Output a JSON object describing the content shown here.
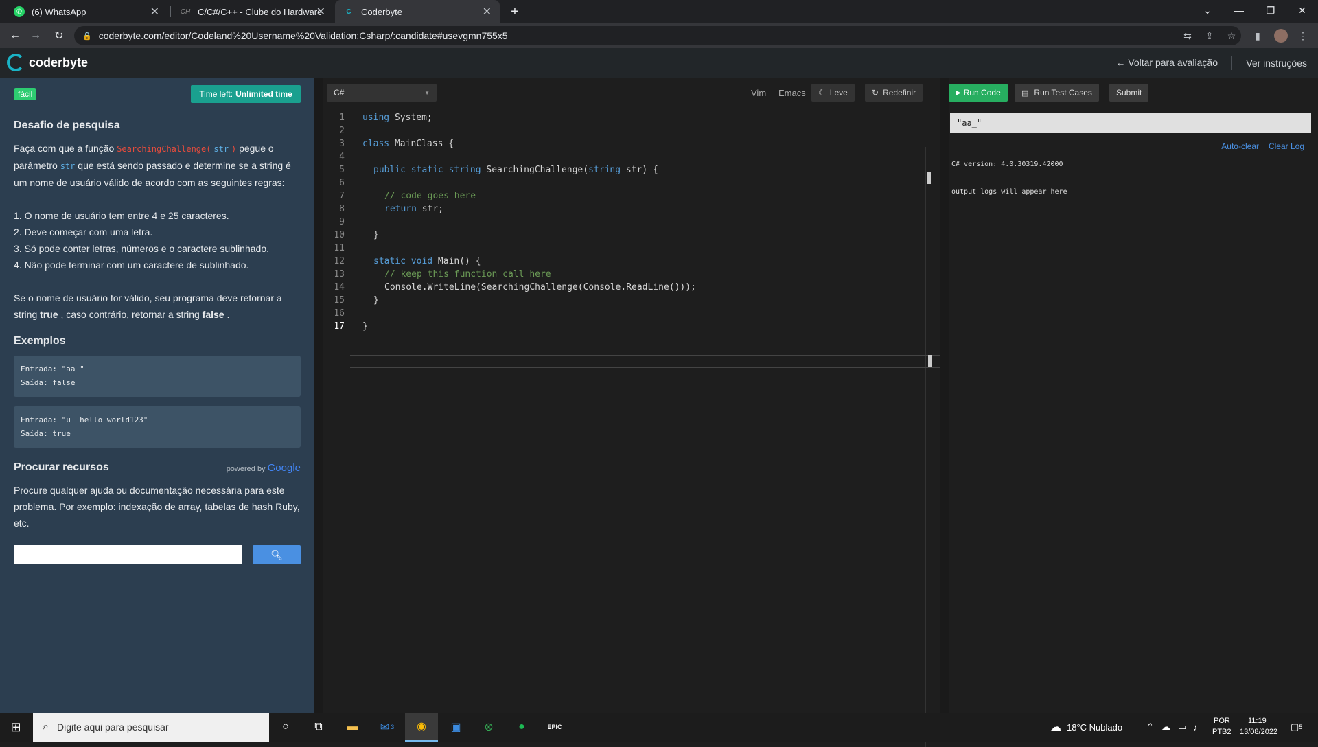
{
  "browser": {
    "tabs": [
      {
        "title": "(6) WhatsApp",
        "icon": "whatsapp-icon"
      },
      {
        "title": "C/C#/C++ - Clube do Hardware",
        "icon": "clube-do-hardware-icon"
      },
      {
        "title": "Coderbyte",
        "icon": "coderbyte-icon",
        "active": true
      }
    ],
    "url": "coderbyte.com/editor/Codeland%20Username%20Validation:Csharp/:candidate#usevgmn755x5"
  },
  "header": {
    "logo_text": "coderbyte",
    "back_link": "← Voltar para avaliação",
    "instructions_link": "Ver instruções"
  },
  "challenge": {
    "difficulty": "fácil",
    "time_left_label": "Time left:",
    "time_left_value": "Unlimited time",
    "title": "Desafio de pesquisa",
    "intro_1": "Faça com que a função",
    "func_name": "SearchingChallenge(",
    "func_param": "str",
    "func_close": ")",
    "intro_2": "pegue o parâmetro",
    "param_name": "str",
    "intro_3": "que está sendo passado e determine se a string é um nome de usuário válido de acordo com as seguintes regras:",
    "rules": [
      "1. O nome de usuário tem entre 4 e 25 caracteres.",
      "2. Deve começar com uma letra.",
      "3. Só pode conter letras, números e o caractere sublinhado.",
      "4. Não pode terminar com um caractere de sublinhado."
    ],
    "result_1": "Se o nome de usuário for válido, seu programa deve retornar a string",
    "true_word": "true",
    "result_2": ", caso contrário, retornar a string",
    "false_word": "false",
    "result_3": ".",
    "examples_title": "Exemplos",
    "examples": [
      {
        "input": "Entrada: \"aa_\"",
        "output": "Saída: false"
      },
      {
        "input": "Entrada: \"u__hello_world123\"",
        "output": "Saída: true"
      }
    ],
    "resources_title": "Procurar recursos",
    "powered_by": "powered by",
    "google": "Google",
    "resources_text": "Procure qualquer ajuda ou documentação necessária para este problema. Por exemplo: indexação de array, tabelas de hash Ruby, etc.",
    "search_value": ""
  },
  "editor": {
    "language": "C#",
    "vim": "Vim",
    "emacs": "Emacs",
    "theme_btn": "Leve",
    "reset_btn": "Redefinir",
    "line_numbers": [
      "1",
      "2",
      "3",
      "4",
      "5",
      "6",
      "7",
      "8",
      "9",
      "10",
      "11",
      "12",
      "13",
      "14",
      "15",
      "16",
      "17"
    ],
    "lines": {
      "l1_kw": "using",
      "l1_rest": " System;",
      "l3_kw": "class",
      "l3_rest": " MainClass {",
      "l5_kw1": "public static string",
      "l5_mid": " SearchingChallenge(",
      "l5_kw2": "string",
      "l5_rest": " str) {",
      "l7_cm": "// code goes here",
      "l8_kw": "return",
      "l8_rest": " str;",
      "l10": "}",
      "l12_kw": "static void",
      "l12_rest": " Main() {",
      "l13_cm": "// keep this function call here",
      "l14": "Console.WriteLine(SearchingChallenge(Console.ReadLine()));",
      "l15": "}",
      "l17": "}"
    }
  },
  "output": {
    "run_code": "Run Code",
    "run_tests": "Run Test Cases",
    "submit": "Submit",
    "stdin_value": "\"aa_\"",
    "auto_clear": "Auto-clear",
    "clear_log": "Clear Log",
    "version_line": "C# version: 4.0.30319.42000",
    "placeholder_line": "output logs will appear here"
  },
  "taskbar": {
    "search_placeholder": "Digite aqui para pesquisar",
    "mail_badge": "3",
    "weather": "18°C  Nublado",
    "lang_1": "POR",
    "lang_2": "PTB2",
    "time": "11:19",
    "date": "13/08/2022",
    "notif_count": "5"
  },
  "colors": {
    "accent_teal": "#1aa08f",
    "run_green": "#27ae60",
    "easy_green": "#2ecc71",
    "left_panel_bg": "#2c3e50"
  }
}
